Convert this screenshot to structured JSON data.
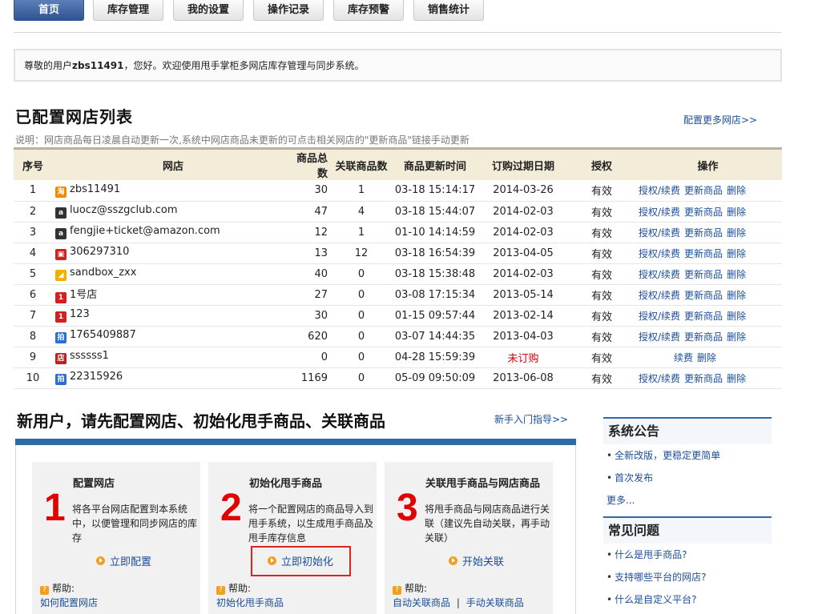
{
  "tabs": [
    "首页",
    "库存管理",
    "我的设置",
    "操作记录",
    "库存预警",
    "销售统计"
  ],
  "welcome": {
    "prefix": "尊敬的用户",
    "user": "zbs11491",
    "suffix": "，您好。欢迎使用甩手掌柜多网店库存管理与同步系统。"
  },
  "shops_section": {
    "title": "已配置网店列表",
    "more_link": "配置更多网店>>",
    "note": "说明：网店商品每日凌晨自动更新一次,系统中网店商品未更新的可点击相关网店的\"更新商品\"链接手动更新",
    "columns": [
      "序号",
      "网店",
      "商品总数",
      "关联商品数",
      "商品更新时间",
      "订购过期日期",
      "授权",
      "操作"
    ],
    "rows": [
      {
        "no": "1",
        "icon": "taobao-icon",
        "icon_color": "#f08a00",
        "icon_char": "淘",
        "shop": "zbs11491",
        "total": "30",
        "linked": "1",
        "updated": "03-18 15:14:17",
        "expire": "2014-03-26",
        "auth": "有效",
        "ops": [
          "授权/续费",
          "更新商品",
          "删除"
        ]
      },
      {
        "no": "2",
        "icon": "amazon-icon",
        "icon_color": "#333333",
        "icon_char": "a",
        "shop": "luocz@sszgclub.com",
        "total": "47",
        "linked": "4",
        "updated": "03-18 15:44:07",
        "expire": "2014-02-03",
        "auth": "有效",
        "ops": [
          "授权/续费",
          "更新商品",
          "删除"
        ]
      },
      {
        "no": "3",
        "icon": "amazon-icon",
        "icon_color": "#333333",
        "icon_char": "a",
        "shop": "fengjie+ticket@amazon.com",
        "total": "12",
        "linked": "1",
        "updated": "01-10 14:14:59",
        "expire": "2014-02-03",
        "auth": "有效",
        "ops": [
          "授权/续费",
          "更新商品",
          "删除"
        ]
      },
      {
        "no": "4",
        "icon": "shop-bag-icon",
        "icon_color": "#d42020",
        "icon_char": "▣",
        "shop": "306297310",
        "total": "13",
        "linked": "12",
        "updated": "03-18 16:54:39",
        "expire": "2013-04-05",
        "auth": "有效",
        "ops": [
          "授权/续费",
          "更新商品",
          "删除"
        ]
      },
      {
        "no": "5",
        "icon": "sandbox-icon",
        "icon_color": "#f0b000",
        "icon_char": "◢",
        "shop": "sandbox_zxx",
        "total": "40",
        "linked": "0",
        "updated": "03-18 15:38:48",
        "expire": "2014-02-03",
        "auth": "有效",
        "ops": [
          "授权/续费",
          "更新商品",
          "删除"
        ]
      },
      {
        "no": "6",
        "icon": "yhd-icon",
        "icon_color": "#d42020",
        "icon_char": "1",
        "shop": "1号店",
        "total": "27",
        "linked": "0",
        "updated": "03-08 17:15:34",
        "expire": "2013-05-14",
        "auth": "有效",
        "ops": [
          "授权/续费",
          "更新商品",
          "删除"
        ]
      },
      {
        "no": "7",
        "icon": "yhd-icon",
        "icon_color": "#d42020",
        "icon_char": "1",
        "shop": "123",
        "total": "30",
        "linked": "0",
        "updated": "01-15 09:57:44",
        "expire": "2013-02-14",
        "auth": "有效",
        "ops": [
          "授权/续费",
          "更新商品",
          "删除"
        ]
      },
      {
        "no": "8",
        "icon": "paipai-icon",
        "icon_color": "#2a6fd0",
        "icon_char": "拍",
        "shop": "1765409887",
        "total": "620",
        "linked": "0",
        "updated": "03-07 14:44:35",
        "expire": "2013-04-03",
        "auth": "有效",
        "ops": [
          "授权/续费",
          "更新商品",
          "删除"
        ]
      },
      {
        "no": "9",
        "icon": "store-icon",
        "icon_color": "#c02020",
        "icon_char": "店",
        "shop": "ssssss1",
        "total": "0",
        "linked": "0",
        "updated": "04-28 15:59:39",
        "expire": "未订购",
        "expire_red": true,
        "auth": "有效",
        "ops": [
          "续费",
          "删除"
        ]
      },
      {
        "no": "10",
        "icon": "paipai-icon",
        "icon_color": "#2a6fd0",
        "icon_char": "拍",
        "shop": "22315926",
        "total": "1169",
        "linked": "0",
        "updated": "05-09 09:50:09",
        "expire": "2013-06-08",
        "auth": "有效",
        "ops": [
          "授权/续费",
          "更新商品",
          "删除"
        ]
      }
    ]
  },
  "new_user": {
    "title": "新用户，请先配置网店、初始化甩手商品、关联商品",
    "guide_link": "新手入门指导>>",
    "help_label": "帮助:",
    "steps": [
      {
        "num": "1",
        "title": "配置网店",
        "desc": "将各平台网店配置到本系统中，以便管理和同步网店的库存",
        "action": "立即配置",
        "help": [
          "如何配置网店"
        ]
      },
      {
        "num": "2",
        "title": "初始化甩手商品",
        "desc": "将一个配置网店的商品导入到甩手系统，以生成甩手商品及甩手库存信息",
        "action": "立即初始化",
        "help": [
          "初始化甩手商品"
        ]
      },
      {
        "num": "3",
        "title": "关联甩手商品与网店商品",
        "desc": "将甩手商品与网店商品进行关联（建议先自动关联，再手动关联）",
        "action": "开始关联",
        "help": [
          "自动关联商品",
          "手动关联商品"
        ]
      }
    ]
  },
  "sidebar": {
    "announce_title": "系统公告",
    "announce_items": [
      "全新改版，更稳定更简单",
      "首次发布"
    ],
    "more": "更多...",
    "faq_title": "常见问题",
    "faq_items": [
      "什么是甩手商品?",
      "支持哪些平台的网店?",
      "什么是自定义平台?"
    ]
  }
}
